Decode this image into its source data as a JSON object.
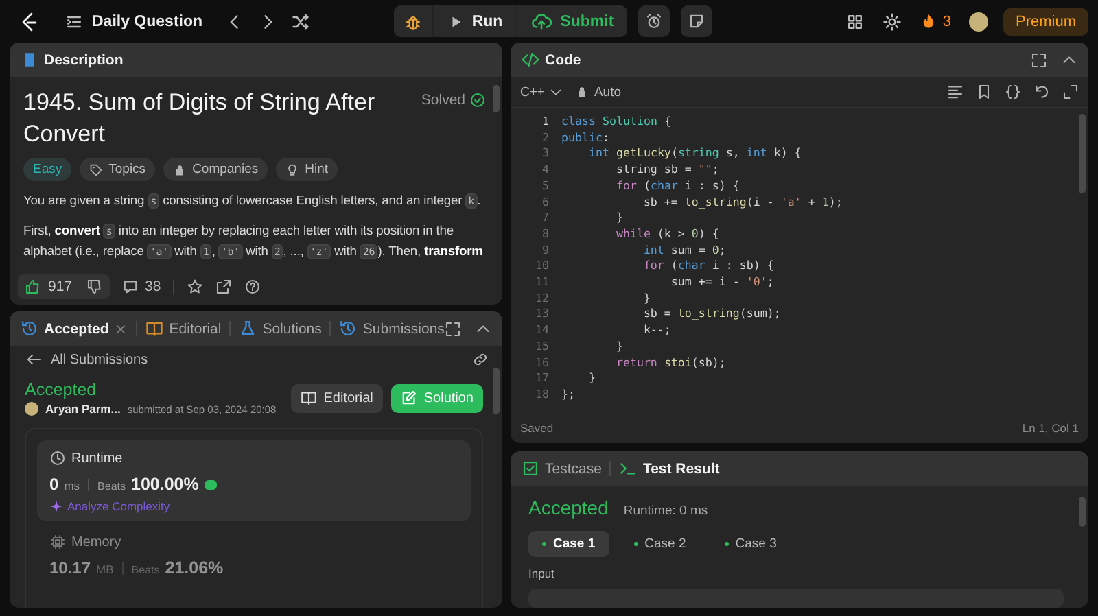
{
  "topbar": {
    "title": "Daily Question",
    "run": "Run",
    "submit": "Submit",
    "streak": "3",
    "premium": "Premium"
  },
  "description": {
    "tab": "Description",
    "title": "1945. Sum of Digits of String After Convert",
    "status": "Solved",
    "tags": [
      {
        "kind": "difficulty",
        "label": "Easy"
      },
      {
        "kind": "topics",
        "label": "Topics"
      },
      {
        "kind": "companies",
        "label": "Companies"
      },
      {
        "kind": "hint",
        "label": "Hint"
      }
    ],
    "paragraphs": [
      [
        {
          "kind": "text",
          "text": "You are given a string "
        },
        {
          "kind": "code",
          "text": "s"
        },
        {
          "kind": "text",
          "text": " consisting of lowercase English letters, and an integer "
        },
        {
          "kind": "code",
          "text": "k"
        },
        {
          "kind": "text",
          "text": "."
        }
      ],
      [
        {
          "kind": "text",
          "text": "First, "
        },
        {
          "kind": "bold",
          "text": "convert "
        },
        {
          "kind": "code",
          "text": "s"
        },
        {
          "kind": "text",
          "text": " into an integer by replacing each letter with its position in the alphabet (i.e., replace "
        },
        {
          "kind": "code",
          "text": "'a'"
        },
        {
          "kind": "text",
          "text": " with "
        },
        {
          "kind": "code",
          "text": "1"
        },
        {
          "kind": "text",
          "text": ", "
        },
        {
          "kind": "code",
          "text": "'b'"
        },
        {
          "kind": "text",
          "text": " with "
        },
        {
          "kind": "code",
          "text": "2"
        },
        {
          "kind": "text",
          "text": ", ..., "
        },
        {
          "kind": "code",
          "text": "'z'"
        },
        {
          "kind": "text",
          "text": " with "
        },
        {
          "kind": "code",
          "text": "26"
        },
        {
          "kind": "text",
          "text": "). Then, "
        },
        {
          "kind": "bold",
          "text": "transform"
        }
      ]
    ],
    "likes": "917",
    "comments": "38"
  },
  "submission": {
    "tabs": [
      {
        "kind": "accepted",
        "label": "Accepted",
        "selected": true,
        "closable": true
      },
      {
        "kind": "editorial",
        "label": "Editorial",
        "selected": false,
        "closable": false
      },
      {
        "kind": "solutions",
        "label": "Solutions",
        "selected": false,
        "closable": false
      },
      {
        "kind": "submissions",
        "label": "Submissions",
        "selected": false,
        "closable": false
      }
    ],
    "back": "All Submissions",
    "verdict": "Accepted",
    "author": "Aryan Parm...",
    "submitted": "submitted at Sep 03, 2024 20:08",
    "buttons": [
      {
        "kind": "editorial",
        "label": "Editorial"
      },
      {
        "kind": "solution",
        "label": "Solution"
      }
    ],
    "runtime": {
      "label": "Runtime",
      "value": "0",
      "unit": "ms",
      "beats_label": "Beats",
      "beats": "100.00%"
    },
    "analyze": "Analyze Complexity",
    "memory": {
      "label": "Memory",
      "value": "10.17",
      "unit": "MB",
      "beats_label": "Beats",
      "beats": "21.06%"
    }
  },
  "code": {
    "tab": "Code",
    "language": "C++",
    "mode": "Auto",
    "status": "Saved",
    "cursor": "Ln 1, Col 1",
    "lines": [
      {
        "number": "1",
        "tokens": [
          {
            "kind": "kw",
            "text": "class "
          },
          {
            "kind": "type",
            "text": "Solution"
          },
          {
            "kind": "plain",
            "text": " {"
          }
        ]
      },
      {
        "number": "2",
        "tokens": [
          {
            "kind": "kw",
            "text": "public"
          },
          {
            "kind": "plain",
            "text": ":"
          }
        ]
      },
      {
        "number": "3",
        "tokens": [
          {
            "kind": "kw",
            "text": "    int "
          },
          {
            "kind": "fn",
            "text": "getLucky"
          },
          {
            "kind": "plain",
            "text": "("
          },
          {
            "kind": "type",
            "text": "string"
          },
          {
            "kind": "plain",
            "text": " s, "
          },
          {
            "kind": "kw",
            "text": "int"
          },
          {
            "kind": "plain",
            "text": " k) {"
          }
        ]
      },
      {
        "number": "4",
        "tokens": [
          {
            "kind": "plain",
            "text": "        string sb = "
          },
          {
            "kind": "str",
            "text": "\"\""
          },
          {
            "kind": "plain",
            "text": ";"
          }
        ]
      },
      {
        "number": "5",
        "tokens": [
          {
            "kind": "ctl",
            "text": "        for"
          },
          {
            "kind": "plain",
            "text": " ("
          },
          {
            "kind": "kw",
            "text": "char"
          },
          {
            "kind": "plain",
            "text": " i : s) {"
          }
        ]
      },
      {
        "number": "6",
        "tokens": [
          {
            "kind": "plain",
            "text": "            sb += "
          },
          {
            "kind": "fn",
            "text": "to_string"
          },
          {
            "kind": "plain",
            "text": "(i - "
          },
          {
            "kind": "str",
            "text": "'a'"
          },
          {
            "kind": "plain",
            "text": " + "
          },
          {
            "kind": "num",
            "text": "1"
          },
          {
            "kind": "plain",
            "text": ");"
          }
        ]
      },
      {
        "number": "7",
        "tokens": [
          {
            "kind": "plain",
            "text": "        }"
          }
        ]
      },
      {
        "number": "8",
        "tokens": [
          {
            "kind": "ctl",
            "text": "        while"
          },
          {
            "kind": "plain",
            "text": " (k > "
          },
          {
            "kind": "num",
            "text": "0"
          },
          {
            "kind": "plain",
            "text": ") {"
          }
        ]
      },
      {
        "number": "9",
        "tokens": [
          {
            "kind": "kw",
            "text": "            int"
          },
          {
            "kind": "plain",
            "text": " sum = "
          },
          {
            "kind": "num",
            "text": "0"
          },
          {
            "kind": "plain",
            "text": ";"
          }
        ]
      },
      {
        "number": "10",
        "tokens": [
          {
            "kind": "ctl",
            "text": "            for"
          },
          {
            "kind": "plain",
            "text": " ("
          },
          {
            "kind": "kw",
            "text": "char"
          },
          {
            "kind": "plain",
            "text": " i : sb) {"
          }
        ]
      },
      {
        "number": "11",
        "tokens": [
          {
            "kind": "plain",
            "text": "                sum += i - "
          },
          {
            "kind": "str",
            "text": "'0'"
          },
          {
            "kind": "plain",
            "text": ";"
          }
        ]
      },
      {
        "number": "12",
        "tokens": [
          {
            "kind": "plain",
            "text": "            }"
          }
        ]
      },
      {
        "number": "13",
        "tokens": [
          {
            "kind": "plain",
            "text": "            sb = "
          },
          {
            "kind": "fn",
            "text": "to_string"
          },
          {
            "kind": "plain",
            "text": "(sum);"
          }
        ]
      },
      {
        "number": "14",
        "tokens": [
          {
            "kind": "plain",
            "text": "            k--;"
          }
        ]
      },
      {
        "number": "15",
        "tokens": [
          {
            "kind": "plain",
            "text": "        }"
          }
        ]
      },
      {
        "number": "16",
        "tokens": [
          {
            "kind": "ctl",
            "text": "        return "
          },
          {
            "kind": "fn",
            "text": "stoi"
          },
          {
            "kind": "plain",
            "text": "(sb);"
          }
        ]
      },
      {
        "number": "17",
        "tokens": [
          {
            "kind": "plain",
            "text": "    }"
          }
        ]
      },
      {
        "number": "18",
        "tokens": [
          {
            "kind": "plain",
            "text": "};"
          }
        ]
      }
    ]
  },
  "test": {
    "tabs": [
      {
        "kind": "testcase",
        "label": "Testcase",
        "selected": false
      },
      {
        "kind": "result",
        "label": "Test Result",
        "selected": true
      }
    ],
    "verdict": "Accepted",
    "runtime": "Runtime: 0 ms",
    "cases": [
      {
        "label": "Case 1",
        "selected": true
      },
      {
        "label": "Case 2",
        "selected": false
      },
      {
        "label": "Case 3",
        "selected": false
      }
    ],
    "input_label": "Input"
  }
}
